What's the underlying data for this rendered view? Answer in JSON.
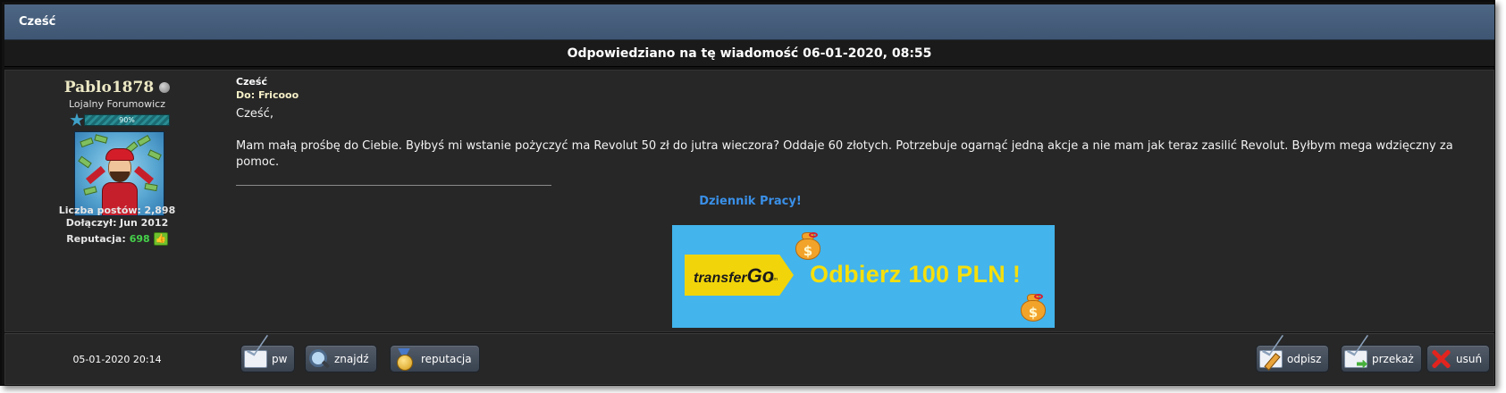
{
  "header": {
    "title": "Cześć",
    "reply_notice": "Odpowiedziano na tę wiadomość 06-01-2020, 08:55"
  },
  "user": {
    "username": "Pablo1878",
    "status": "offline",
    "title": "Lojalny Forumowicz",
    "rank_progress_label": "90%",
    "rank_progress": 0.9,
    "posts_label": "Liczba postów:",
    "posts_value": "2,898",
    "joined_label": "Dołączył:",
    "joined_value": "Jun 2012",
    "reputation_label": "Reputacja:",
    "reputation_value": "698"
  },
  "message": {
    "title": "Cześć",
    "to_label": "Do:",
    "to_user": "Fricooo",
    "greeting": "Cześć,",
    "body": "Mam małą prośbę do Ciebie. Byłbyś mi wstanie pożyczyć ma Revolut 50 zł do jutra wieczora? Oddaje 60 złotych. Potrzebuje ogarnąć jedną akcje a nie mam jak teraz zasilić Revolut. Byłbym mega wdzięczny za pomoc.",
    "signature_link": "Dziennik Pracy!",
    "banner": {
      "logo_text": "transfer",
      "logo_text_2": "Go",
      "logo_sub": ".com",
      "headline": "Odbierz 100 PLN !"
    }
  },
  "footer": {
    "date": "05-01-2020 20:14",
    "buttons_left": [
      "pw",
      "znajdź",
      "reputacja"
    ],
    "buttons_right": [
      "odpisz",
      "przekaż",
      "usuń"
    ]
  },
  "colors": {
    "header_bg": "#44607d",
    "panel_bg": "#272727",
    "username": "#ece8c4",
    "link": "#3a90e8",
    "reputation": "#45d14a",
    "banner_bg": "#43b4ec",
    "banner_text": "#f5df0c"
  }
}
